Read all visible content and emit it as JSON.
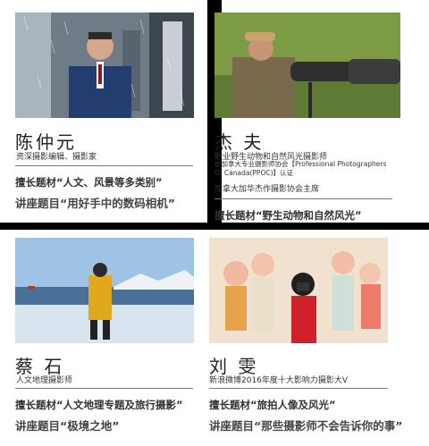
{
  "cards": [
    {
      "name": "陈仲元",
      "subtitle": "资深摄影编辑、摄影家",
      "topic": "擅长题材“人文、风景等多类别”",
      "lecture": "讲座题目“用好手中的数码相机”"
    },
    {
      "name": "杰 夫",
      "subtitle": "职业野生动物和自然风光摄影师",
      "cert": "由加拿大专业摄影师协会【Professional Photographers Of Canada(PPOC)】认证",
      "association": "加拿大加华杰作摄影协会主席",
      "topic": "擅长题材“野生动物和自然风光”"
    },
    {
      "name": "蔡 石",
      "subtitle": "人文地理摄影师",
      "topic": "擅长题材“人文地理专题及旅行摄影”",
      "lecture": "讲座题目“极境之地”"
    },
    {
      "name": "刘 雯",
      "subtitle": "新浪微博2016年度十大影响力摄影大V",
      "topic": "擅长题材“旅拍人像及风光”",
      "lecture": "讲座题目“那些摄影师不会告诉你的事”"
    }
  ]
}
